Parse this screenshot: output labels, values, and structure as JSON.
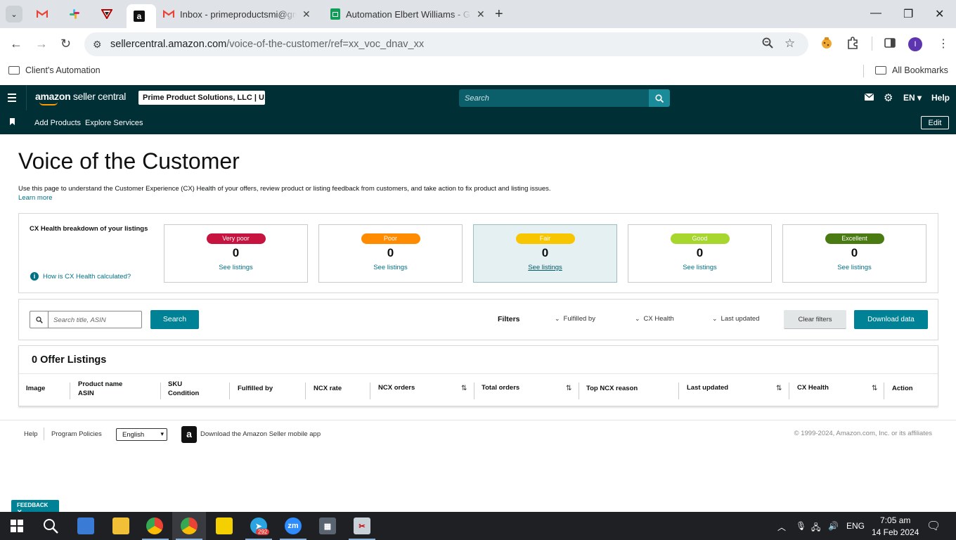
{
  "browser": {
    "tabs": [
      {
        "title": "Inbox - primeproductsmi@gmail.com",
        "icon": "gmail-icon"
      },
      {
        "title": "Automation Elbert Williams - Google Sheets",
        "icon": "sheets-icon"
      }
    ],
    "url_host": "sellercentral.amazon.com",
    "url_path": "/voice-of-the-customer/ref=xx_voc_dnav_xx",
    "bookmarks": {
      "left": "Client's Automation",
      "right": "All Bookmarks"
    },
    "profile_initial": "I"
  },
  "header": {
    "logo_main": "amazon",
    "logo_sub": "seller central",
    "account": "Prime Product Solutions, LLC | U...",
    "search_placeholder": "Search",
    "language": "EN",
    "help": "Help",
    "sub_links": [
      "Add Products",
      "Explore Services"
    ],
    "edit": "Edit"
  },
  "page": {
    "title": "Voice of the Customer",
    "description": "Use this page to understand the Customer Experience (CX) Health of your offers, review product or listing feedback from customers, and take action to fix product and listing issues.",
    "learn_more": "Learn more"
  },
  "cx_health": {
    "label": "CX Health breakdown of your listings",
    "info_link": "How is CX Health calculated?",
    "cards": [
      {
        "label": "Very poor",
        "count": "0",
        "link": "See listings",
        "color": "#c7133f"
      },
      {
        "label": "Poor",
        "count": "0",
        "link": "See listings",
        "color": "#ff8c00"
      },
      {
        "label": "Fair",
        "count": "0",
        "link": "See listings",
        "color": "#f7c600"
      },
      {
        "label": "Good",
        "count": "0",
        "link": "See listings",
        "color": "#a7d62e"
      },
      {
        "label": "Excellent",
        "count": "0",
        "link": "See listings",
        "color": "#4a7a12"
      }
    ]
  },
  "filters": {
    "search_placeholder": "Search title, ASIN",
    "search_button": "Search",
    "filters_label": "Filters",
    "dropdowns": [
      "Fulfilled by",
      "CX Health",
      "Last updated"
    ],
    "clear": "Clear filters",
    "download": "Download data"
  },
  "table": {
    "title": "0 Offer Listings",
    "columns": [
      {
        "line1": "Image",
        "line2": ""
      },
      {
        "line1": "Product name",
        "line2": "ASIN"
      },
      {
        "line1": "SKU",
        "line2": "Condition"
      },
      {
        "line1": "Fulfilled by",
        "line2": ""
      },
      {
        "line1": "NCX rate",
        "line2": ""
      },
      {
        "line1": "NCX orders",
        "line2": ""
      },
      {
        "line1": "Total orders",
        "line2": ""
      },
      {
        "line1": "Top NCX reason",
        "line2": ""
      },
      {
        "line1": "Last updated",
        "line2": ""
      },
      {
        "line1": "CX Health",
        "line2": ""
      },
      {
        "line1": "Action",
        "line2": ""
      }
    ]
  },
  "footer": {
    "help": "Help",
    "policies": "Program Policies",
    "language": "English",
    "app_link": "Download the Amazon Seller mobile app",
    "copyright": "© 1999-2024, Amazon.com, Inc. or its affiliates",
    "feedback": "FEEDBACK"
  },
  "taskbar": {
    "telegram_badge": "292",
    "language": "ENG",
    "time": "7:05 am",
    "date": "14 Feb 2024"
  }
}
